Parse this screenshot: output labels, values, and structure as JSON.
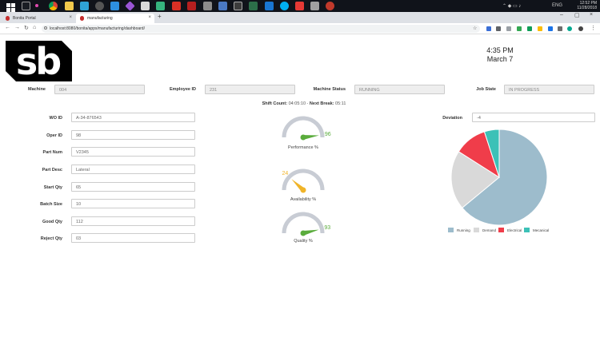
{
  "taskbar": {
    "time": "12:52 PM",
    "date": "11/28/2018",
    "lang": "ENG"
  },
  "browser": {
    "tabs": [
      {
        "label": "Bonita Portal",
        "active": false
      },
      {
        "label": "manufacturing",
        "active": true
      }
    ],
    "url": "localhost:8080/bonita/apps/manufacturing/dashboard/"
  },
  "header": {
    "logo_text": "sb",
    "time": "4:35 PM",
    "date": "March 7"
  },
  "top_fields": [
    {
      "label": "Machine",
      "value": "004"
    },
    {
      "label": "Employee ID",
      "value": "231"
    },
    {
      "label": "Machine Status",
      "value": "RUNNING"
    },
    {
      "label": "Job State",
      "value": "IN PROGRESS"
    }
  ],
  "shift": {
    "count_label": "Shift Count:",
    "count_value": "04:05:10",
    "sep": " - ",
    "break_label": "Next Break:",
    "break_value": "05:11"
  },
  "left_fields": [
    {
      "label": "WO ID",
      "value": "A-34-876543"
    },
    {
      "label": "Oper ID",
      "value": "98"
    },
    {
      "label": "Part Num",
      "value": "V2345"
    },
    {
      "label": "Part Desc",
      "value": "Lateral"
    },
    {
      "label": "Start Qty",
      "value": "65"
    },
    {
      "label": "Batch Size",
      "value": "10"
    },
    {
      "label": "Good Qty",
      "value": "112"
    },
    {
      "label": "Reject Qty",
      "value": "03"
    }
  ],
  "gauges": [
    {
      "label": "Performance %",
      "value": 96,
      "color": "#5aac3c"
    },
    {
      "label": "Availability %",
      "value": 24,
      "color": "#f0b429"
    },
    {
      "label": "Quality %",
      "value": 93,
      "color": "#5aac3c"
    }
  ],
  "deviation": {
    "label": "Deviation",
    "value": "-4"
  },
  "chart_data": {
    "type": "pie",
    "categories": [
      "Running",
      "Demand",
      "Electrical",
      "Mecanical"
    ],
    "values": [
      64,
      20,
      11,
      5
    ],
    "colors": [
      "#9dbccc",
      "#d9d9d9",
      "#f03d4a",
      "#3cc1b7"
    ],
    "legend": "bottom"
  }
}
